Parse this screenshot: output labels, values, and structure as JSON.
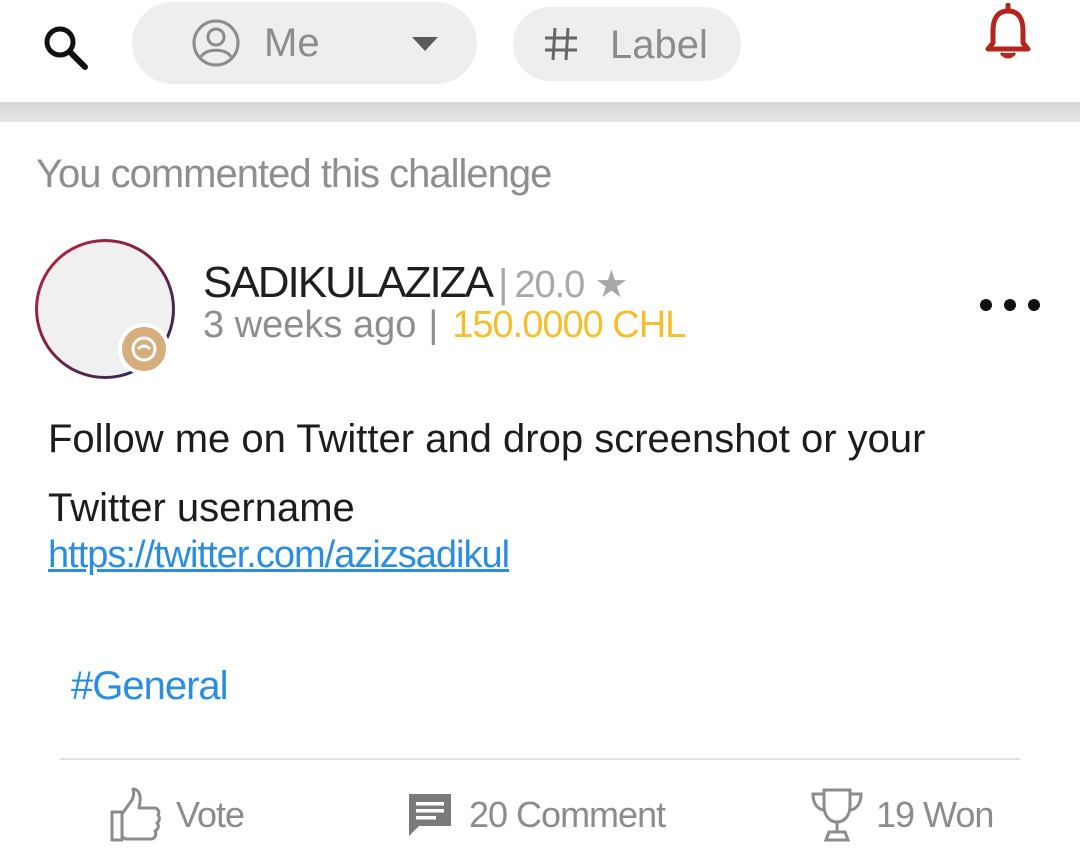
{
  "topbar": {
    "search_icon": "search-icon",
    "user_filter": {
      "icon": "person-circle-icon",
      "label": "Me",
      "dropdown_icon": "caret-down-icon"
    },
    "label_filter": {
      "icon": "hash-icon",
      "label": "Label"
    },
    "notification_icon": "bell-icon",
    "accent_color": "#b3261e"
  },
  "card": {
    "header": "You commented this challenge",
    "author": {
      "username": "SADIKULAZIZA",
      "separator": "|",
      "rating": "20.0",
      "rating_icon": "★",
      "time": "3 weeks ago",
      "reward": "150.0000 CHL",
      "reward_color": "#f3bf2f",
      "badge_icon": "verified-badge-icon"
    },
    "body": {
      "text": "Follow me on Twitter and drop screenshot or your Twitter username",
      "link": "https://twitter.com/azizsadikul"
    },
    "tag": "#General",
    "actions": {
      "vote_label": "Vote",
      "comment_label": "20 Comment",
      "won_label": "19 Won"
    }
  }
}
